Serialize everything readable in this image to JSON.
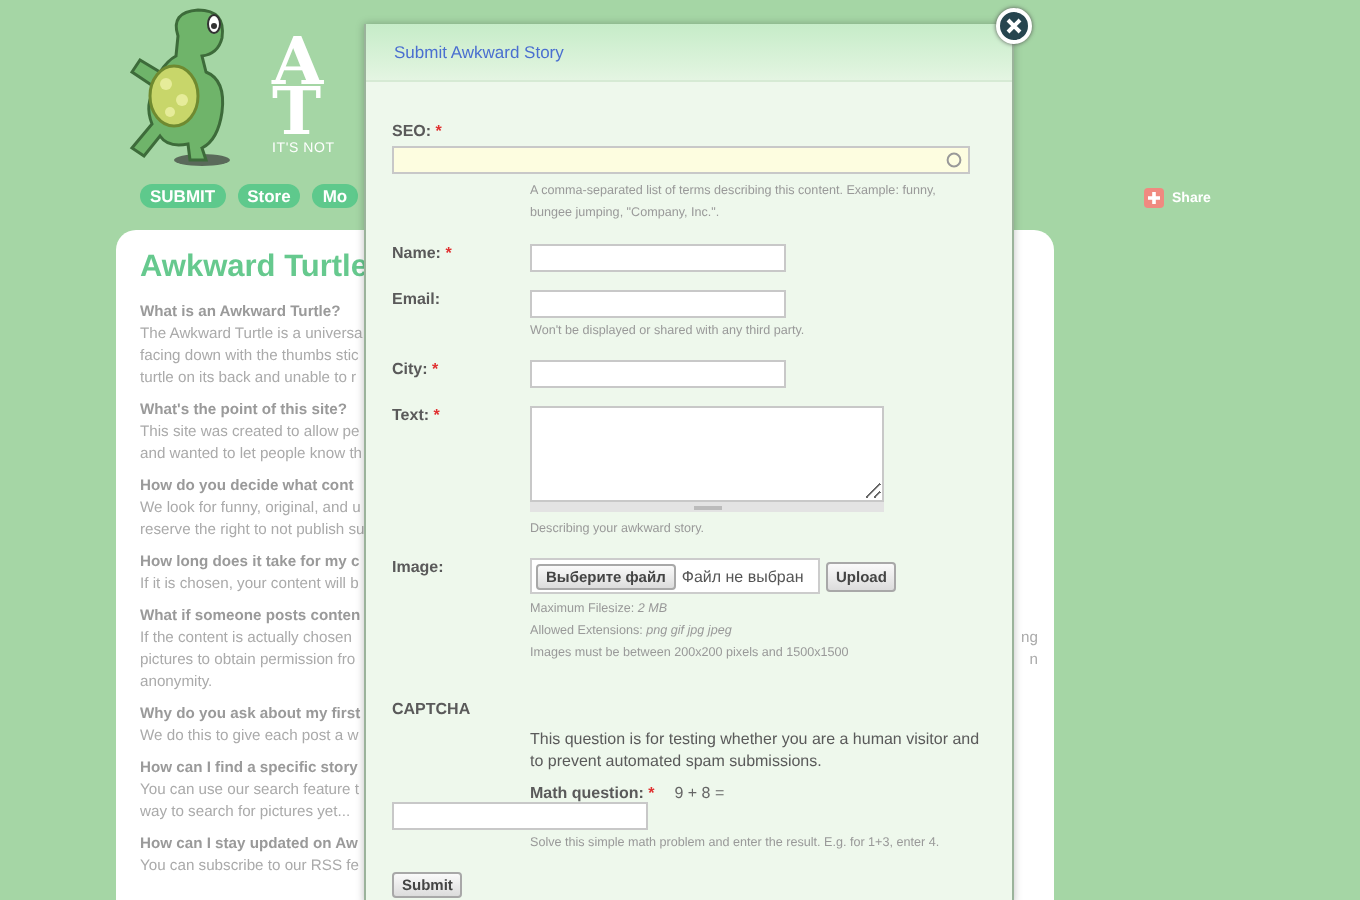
{
  "site": {
    "logo_lines": [
      "A",
      "T"
    ],
    "tagline": "IT'S NOT",
    "nav": [
      {
        "label": "SUBMIT"
      },
      {
        "label": "Store"
      },
      {
        "label": "Mo"
      }
    ],
    "share": {
      "label": "Share"
    }
  },
  "content": {
    "heading": "Awkward Turtle",
    "faq": [
      {
        "question": "What is an Awkward Turtle?",
        "answer_lines": [
          {
            "left": "The Awkward Turtle is a universa"
          },
          {
            "left": "facing down with the thumbs stic"
          },
          {
            "left": "turtle on its back and unable to r"
          }
        ]
      },
      {
        "question": "What's the point of this site?",
        "answer_lines": [
          {
            "left": "This site was created to allow pe"
          },
          {
            "left": "and wanted to let people know th"
          }
        ]
      },
      {
        "question": "How do you decide what cont",
        "answer_lines": [
          {
            "left": "We look for funny, original, and u"
          },
          {
            "left": "reserve the right to not publish su"
          }
        ]
      },
      {
        "question": "How long does it take for my c",
        "answer_lines": [
          {
            "left": "If it is chosen, your content will b"
          }
        ]
      },
      {
        "question": "What if someone posts conten",
        "answer_lines": [
          {
            "left": "If the content is actually chosen",
            "right": "ng"
          },
          {
            "left": "pictures to obtain permission fro",
            "right": "n"
          },
          {
            "left": "anonymity."
          }
        ]
      },
      {
        "question": "Why do you ask about my first",
        "answer_lines": [
          {
            "left": "We do this to give each post a w"
          }
        ]
      },
      {
        "question": "How can I find a specific story",
        "answer_lines": [
          {
            "left": "You can use our search feature t"
          },
          {
            "left": "way to search for pictures yet..."
          }
        ]
      },
      {
        "question": "How can I stay updated on Aw",
        "answer_lines": [
          {
            "left": "You can subscribe to our RSS fe"
          }
        ]
      }
    ]
  },
  "modal": {
    "title": "Submit Awkward Story",
    "fields": [
      {
        "kind": "wide",
        "label": "SEO:",
        "required_mark": "*",
        "hint_lines": [
          "A comma-separated list of terms describing this content. Example: funny,",
          "bungee jumping, \"Company, Inc.\"."
        ]
      },
      {
        "kind": "text",
        "label": "Name:",
        "required_mark": "*"
      },
      {
        "kind": "text",
        "label": "Email:",
        "hint_lines": [
          "Won't be displayed or shared with any third party."
        ]
      },
      {
        "kind": "text",
        "label": "City:",
        "required_mark": "*"
      },
      {
        "kind": "textarea",
        "label": "Text:",
        "required_mark": "*",
        "hint_lines": [
          "Describing your awkward story."
        ]
      },
      {
        "kind": "file",
        "label": "Image:",
        "choose_button": "Выберите файл",
        "file_status": "Файл не выбран",
        "upload_button": "Upload",
        "hint_lines": [
          "Maximum Filesize: *2 MB*",
          "Allowed Extensions: *png gif jpg jpeg*",
          "Images must be between 200x200 pixels and 1500x1500"
        ]
      }
    ],
    "captcha": {
      "heading": "CAPTCHA",
      "description": "This question is for testing whether you are a human visitor and to prevent automated spam submissions.",
      "question_label": "Math question:",
      "required_mark": "*",
      "question": "9 + 8 =",
      "hint": "Solve this simple math problem and enter the result. E.g. for 1+3, enter 4."
    },
    "submit": "Submit"
  }
}
